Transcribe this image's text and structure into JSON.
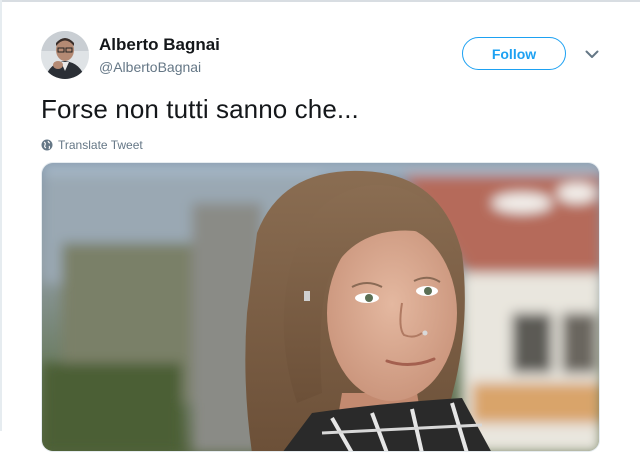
{
  "tweet": {
    "author": {
      "name": "Alberto Bagnai",
      "handle": "@AlbertoBagnai",
      "avatar_icon": "profile-photo"
    },
    "follow_label": "Follow",
    "menu_icon": "chevron-down-icon",
    "text": "Forse non tutti sanno che...",
    "translate_label": "Translate Tweet",
    "translate_icon": "globe-icon",
    "media_description_icon": "photo"
  },
  "colors": {
    "accent": "#1da1f2",
    "text_primary": "#14171a",
    "text_secondary": "#657786"
  }
}
